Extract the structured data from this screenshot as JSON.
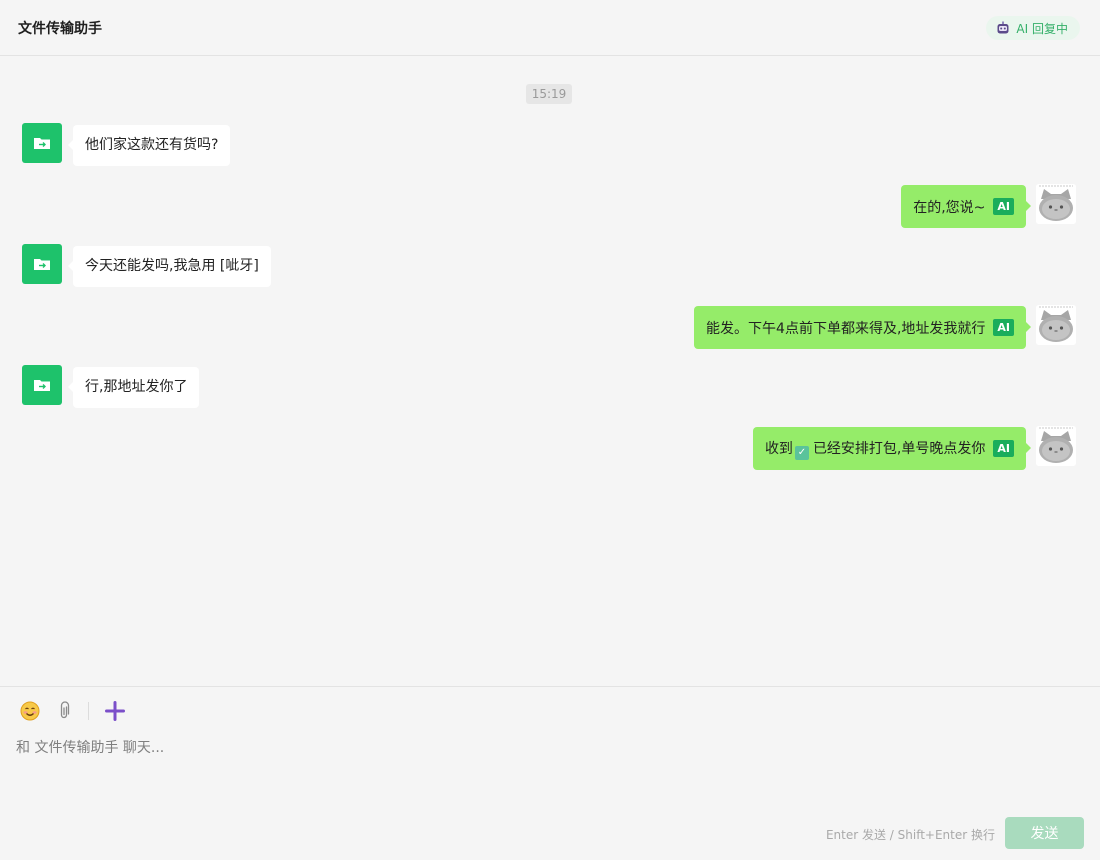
{
  "header": {
    "title": "文件传输助手",
    "ai_status": "AI 回复中"
  },
  "conversation": {
    "timestamp": "15:19",
    "messages": [
      {
        "side": "left",
        "text": "他们家这款还有货吗?"
      },
      {
        "side": "right",
        "text": "在的,您说~",
        "tag": "AI"
      },
      {
        "side": "left",
        "text": "今天还能发吗,我急用 [呲牙]"
      },
      {
        "side": "right",
        "text": "能发。下午4点前下单都来得及,地址发我就行",
        "tag": "AI"
      },
      {
        "side": "left",
        "text": "行,那地址发你了"
      },
      {
        "side": "right",
        "text_before": "收到",
        "text_after": "已经安排打包,单号晚点发你",
        "tag": "AI"
      }
    ]
  },
  "composer": {
    "placeholder": "和 文件传输助手 聊天...",
    "hint": "Enter 发送 / Shift+Enter 换行",
    "send_label": "发送"
  },
  "icons": {
    "left_avatar": "file-transfer-icon",
    "right_avatar": "cat-avatar",
    "toolbar": [
      "emoji-icon",
      "paperclip-icon",
      "plus-icon"
    ],
    "status": "robot-icon"
  },
  "colors": {
    "accent_green": "#1ec26b",
    "outgoing_bubble": "#95ec69",
    "incoming_bubble": "#ffffff",
    "ai_tag": "#1aad5c",
    "plus_icon": "#7b4fc9",
    "send_button_disabled": "#a9dbbe"
  }
}
